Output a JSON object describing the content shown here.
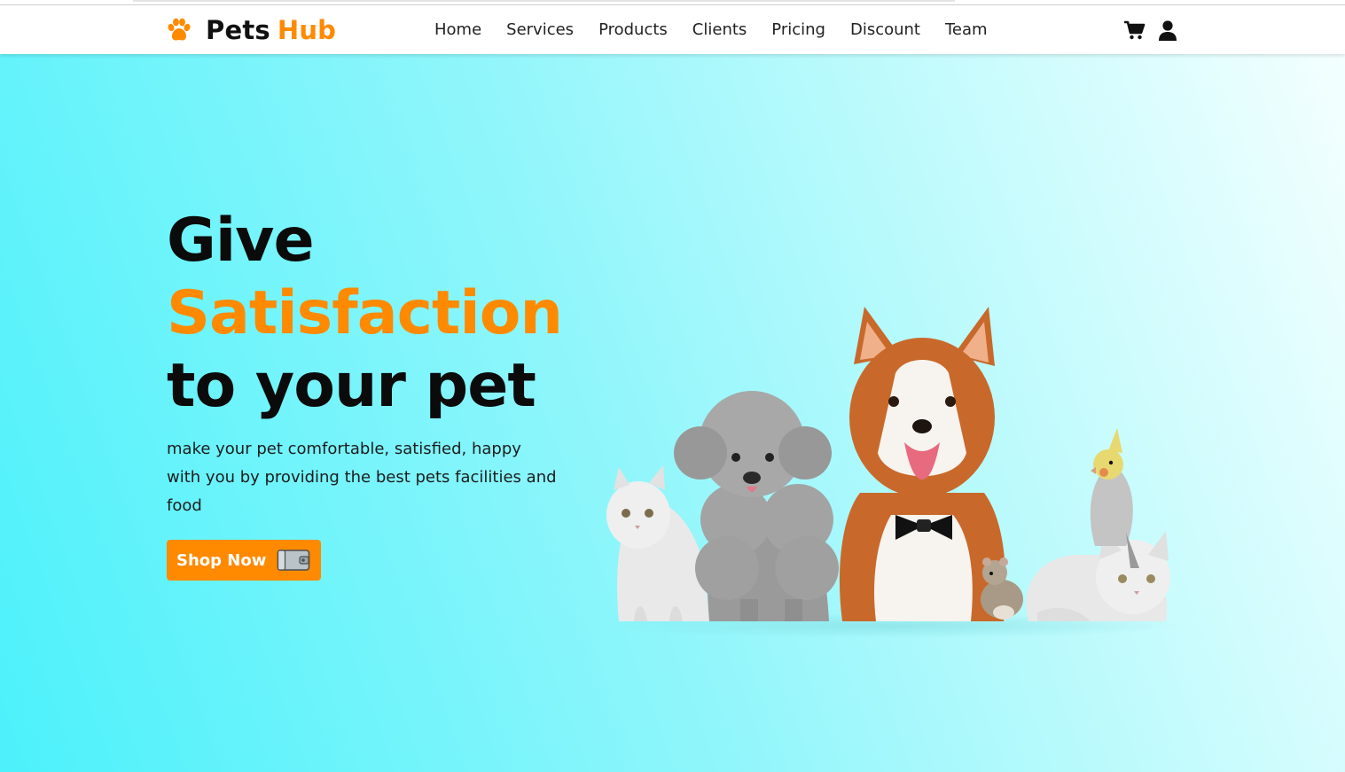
{
  "brand": {
    "name": "Pets",
    "accent": "Hub",
    "accent_color": "#ff8a00",
    "icon": "paw-icon"
  },
  "nav": {
    "items": [
      {
        "label": "Home"
      },
      {
        "label": "Services"
      },
      {
        "label": "Products"
      },
      {
        "label": "Clients"
      },
      {
        "label": "Pricing"
      },
      {
        "label": "Discount"
      },
      {
        "label": "Team"
      }
    ]
  },
  "header_icons": [
    "cart-icon",
    "user-icon"
  ],
  "hero": {
    "line1": "Give",
    "line2": "Satisfaction",
    "line3": "to your pet",
    "subtext": "make your pet comfortable, satisfied, happy with you by providing the best pets facilities and food",
    "cta_label": "Shop Now",
    "cta_icon": "wallet-icon",
    "image": "pets-group-image"
  },
  "colors": {
    "accent": "#ff8a00",
    "hero_gradient_start": "#4cf1fb",
    "hero_gradient_end": "#f4ffff",
    "text": "#0b0b0b"
  }
}
